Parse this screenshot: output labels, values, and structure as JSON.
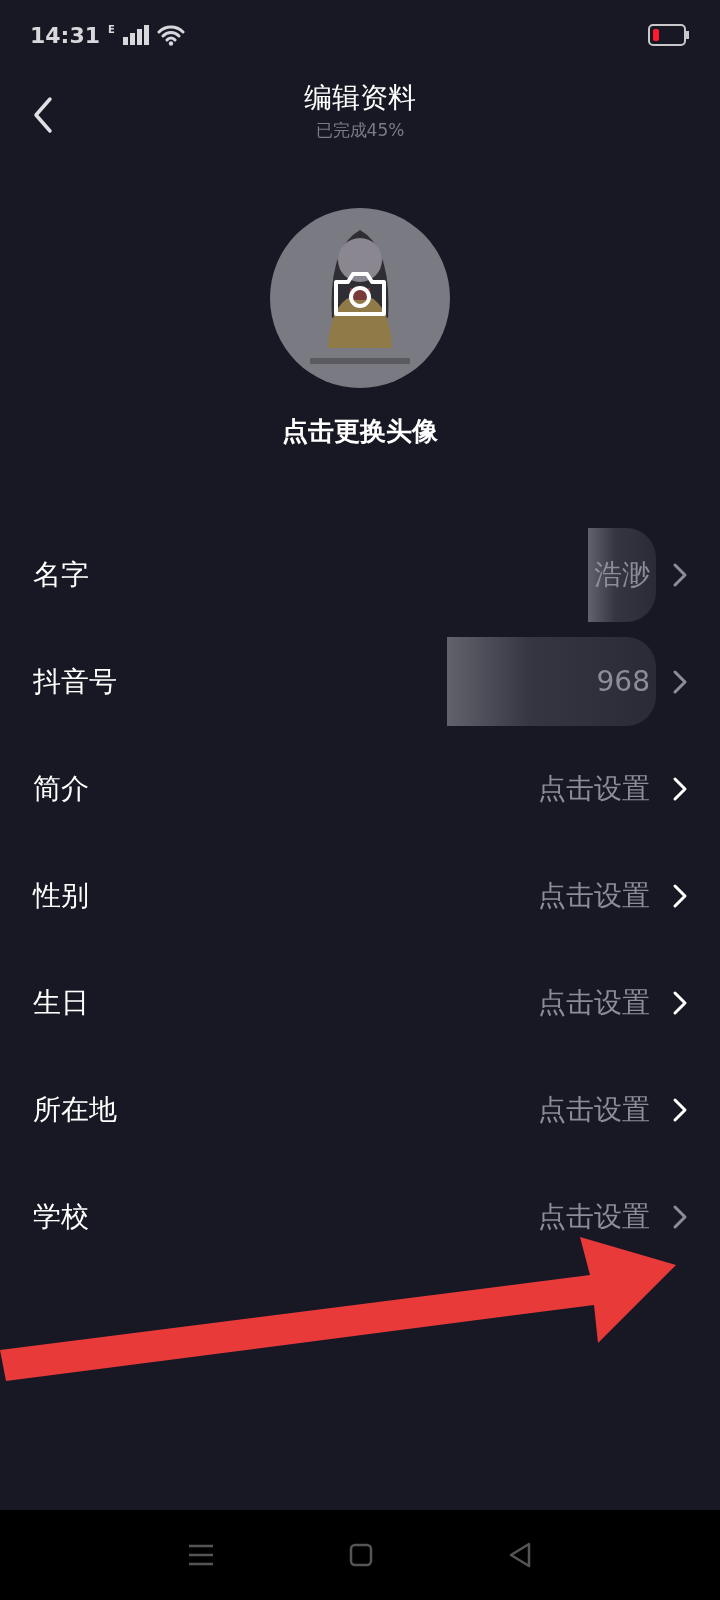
{
  "status_bar": {
    "time": "14:31",
    "network": "E"
  },
  "header": {
    "title": "编辑资料",
    "subtitle": "已完成45%"
  },
  "avatar": {
    "kind": "picture",
    "caption": "点击更换头像"
  },
  "rows": [
    {
      "label": "名字",
      "value": "浩渺",
      "redacted": true,
      "bright": false
    },
    {
      "label": "抖音号",
      "value": "968",
      "redacted": true,
      "bright": false
    },
    {
      "label": "简介",
      "value": "点击设置",
      "redacted": false,
      "bright": true
    },
    {
      "label": "性别",
      "value": "点击设置",
      "redacted": false,
      "bright": true
    },
    {
      "label": "生日",
      "value": "点击设置",
      "redacted": false,
      "bright": true
    },
    {
      "label": "所在地",
      "value": "点击设置",
      "redacted": false,
      "bright": true
    },
    {
      "label": "学校",
      "value": "点击设置",
      "redacted": false,
      "bright": false
    }
  ]
}
